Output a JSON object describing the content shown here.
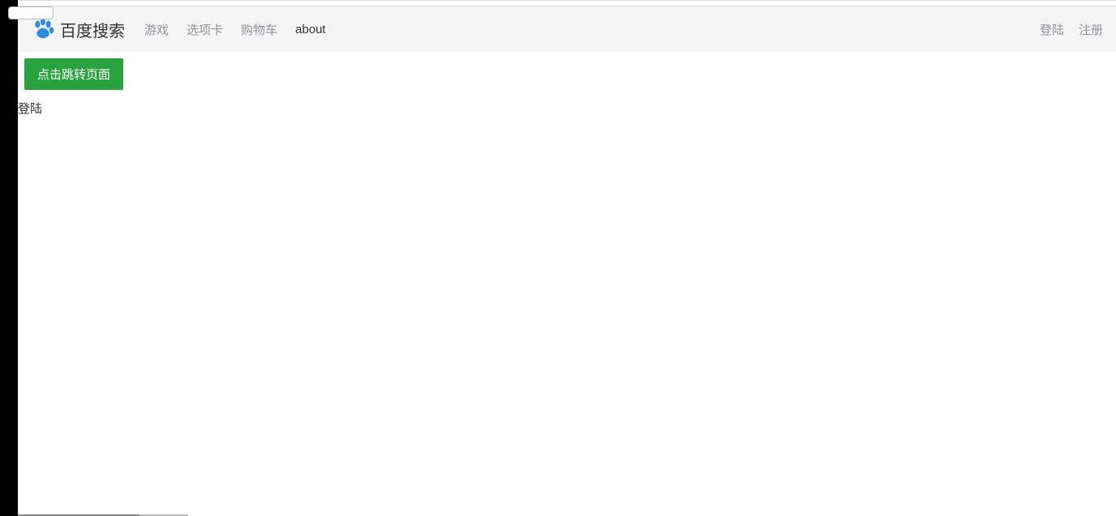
{
  "brand": {
    "text": "百度搜索"
  },
  "nav": {
    "items": [
      {
        "label": "游戏"
      },
      {
        "label": "选项卡"
      },
      {
        "label": "购物车"
      },
      {
        "label": "about"
      }
    ],
    "right": [
      {
        "label": "登陆"
      },
      {
        "label": "注册"
      }
    ]
  },
  "button": {
    "jump": "点击跳转页面"
  },
  "page": {
    "loginText": "登陆"
  },
  "badge": {
    "text": ""
  }
}
